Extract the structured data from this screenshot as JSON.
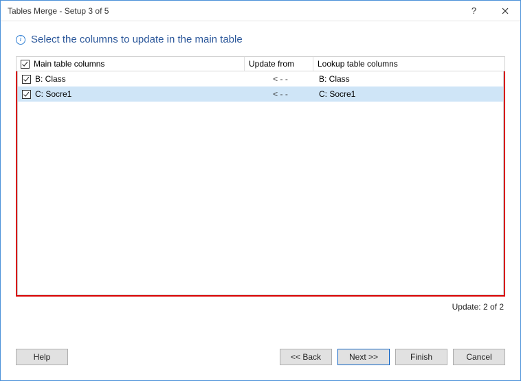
{
  "titlebar": {
    "title": "Tables Merge - Setup 3 of 5"
  },
  "heading": "Select the columns to update in the main table",
  "table": {
    "headers": {
      "main": "Main table columns",
      "update": "Update from",
      "lookup": "Lookup table columns"
    },
    "rows": [
      {
        "main": "B: Class",
        "arrow": "< - -",
        "lookup": "B: Class",
        "checked": true,
        "selected": false
      },
      {
        "main": "C: Socre1",
        "arrow": "< - -",
        "lookup": "C: Socre1",
        "checked": true,
        "selected": true
      }
    ]
  },
  "status": "Update: 2 of 2",
  "buttons": {
    "help": "Help",
    "back": "<< Back",
    "next": "Next >>",
    "finish": "Finish",
    "cancel": "Cancel"
  }
}
